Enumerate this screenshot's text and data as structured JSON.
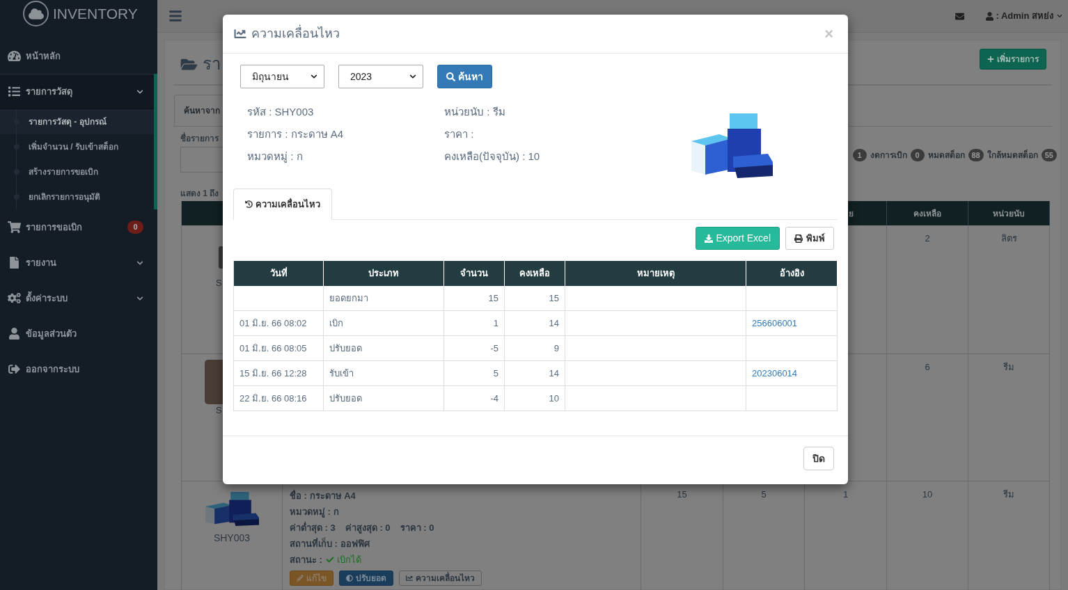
{
  "sidebar": {
    "logo": "INVENTORY",
    "items": [
      {
        "kind": "link",
        "label": "หน้าหลัก"
      },
      {
        "kind": "group",
        "label": "รายการวัสดุ",
        "expanded": true,
        "children": [
          {
            "label": "รายการวัสดุ - อุปกรณ์",
            "selected": true
          },
          {
            "label": "เพิ่มจำนวน / รับเข้าสต็อก",
            "selected": false
          },
          {
            "label": "สร้างรายการขอเบิก",
            "selected": false
          },
          {
            "label": "ยกเลิกรายการอนุมัติ",
            "selected": false
          }
        ]
      },
      {
        "kind": "link",
        "label": "รายการขอเบิก",
        "badge": "0"
      },
      {
        "kind": "group",
        "label": "รายงาน",
        "expanded": false
      },
      {
        "kind": "group",
        "label": "ตั้งค่าระบบ",
        "expanded": false
      },
      {
        "kind": "link",
        "label": "ข้อมูลส่วนตัว"
      },
      {
        "kind": "link",
        "label": "ออกจากระบบ"
      }
    ]
  },
  "top_bar": {
    "user": ": Admin สหย่ง"
  },
  "page": {
    "heading": "รา",
    "add_button": "เพิ่มรายการ",
    "search_tab": "ค้นหาจาก",
    "name_label": "ชื่อรายการ",
    "stats": [
      {
        "value": "1"
      },
      {
        "label": "งดการเบิก",
        "value": "0"
      },
      {
        "label": "หมดสต็อก",
        "value": "88"
      },
      {
        "label": "ใกล้หมดสต็อก",
        "value": "55"
      }
    ],
    "showing": "แสดง 1 ถึง",
    "table": {
      "columns": [
        {
          "label": "ย"
        },
        {
          "label": "คงเหลือ"
        },
        {
          "label": "หน่วยนับ"
        }
      ],
      "rows": [
        {
          "kind": "partial",
          "code": "S",
          "stock": "2",
          "unit": "ลิตร"
        },
        {
          "kind": "partial",
          "code": "S",
          "stock": "6",
          "unit": "รีม"
        },
        {
          "kind": "full",
          "code": "SHY003",
          "name": "ชื่อ : กระดาษ A4",
          "category": "หมวดหมู่ : ก",
          "limits": [
            "ค่าต่ำสุด : 3",
            "ค่าสูงสุด : 0",
            "ราคา : 0"
          ],
          "location": "สถานที่เก็บ : ออฟฟิศ",
          "status": {
            "label": "สถานะ :",
            "value": "เบิกได้",
            "available": true
          },
          "buttons": [
            "แก้ไข",
            "ปรับยอด",
            "ความเคลื่อนไหว"
          ],
          "column_3": "15",
          "column_4": "5",
          "column_5": "1",
          "stock": "10",
          "unit": "รีม"
        }
      ]
    }
  },
  "modal": {
    "title": "ความเคลื่อนไหว",
    "close": "×",
    "month": "มิถุนายน",
    "year": "2023",
    "search_button": "ค้นหา",
    "info_left": [
      "รหัส : SHY003",
      "รายการ : กระดาษ A4",
      "หมวดหมู่ : ก"
    ],
    "info_right": [
      "หน่วยนับ : รีม",
      "ราคา :",
      "คงเหลือ(ปัจจุบัน) : 10"
    ],
    "tabs": [
      {
        "label": "ความเคลื่อนไหว",
        "selected": true
      }
    ],
    "export_button": "Export Excel",
    "print_button": "พิมพ์",
    "table": {
      "columns": [
        "วันที่",
        "ประเภท",
        "จำนวน",
        "คงเหลือ",
        "หมายเหตุ",
        "อ้างอิง"
      ],
      "rows": [
        {
          "type": "ยอดยกมา",
          "qty": "15",
          "balance": "15"
        },
        {
          "date": "01 มิ.ย. 66 08:02",
          "type": "เบิก",
          "qty": "1",
          "balance": "14",
          "ref": "256606001"
        },
        {
          "date": "01 มิ.ย. 66 08:05",
          "type": "ปรับยอด",
          "qty": "-5",
          "balance": "9"
        },
        {
          "date": "15 มิ.ย. 66 12:28",
          "type": "รับเข้า",
          "qty": "5",
          "balance": "14",
          "ref": "202306014"
        },
        {
          "date": "22 มิ.ย. 66 08:16",
          "type": "ปรับยอด",
          "qty": "-4",
          "balance": "10"
        }
      ]
    },
    "close_button": "ปิด"
  }
}
